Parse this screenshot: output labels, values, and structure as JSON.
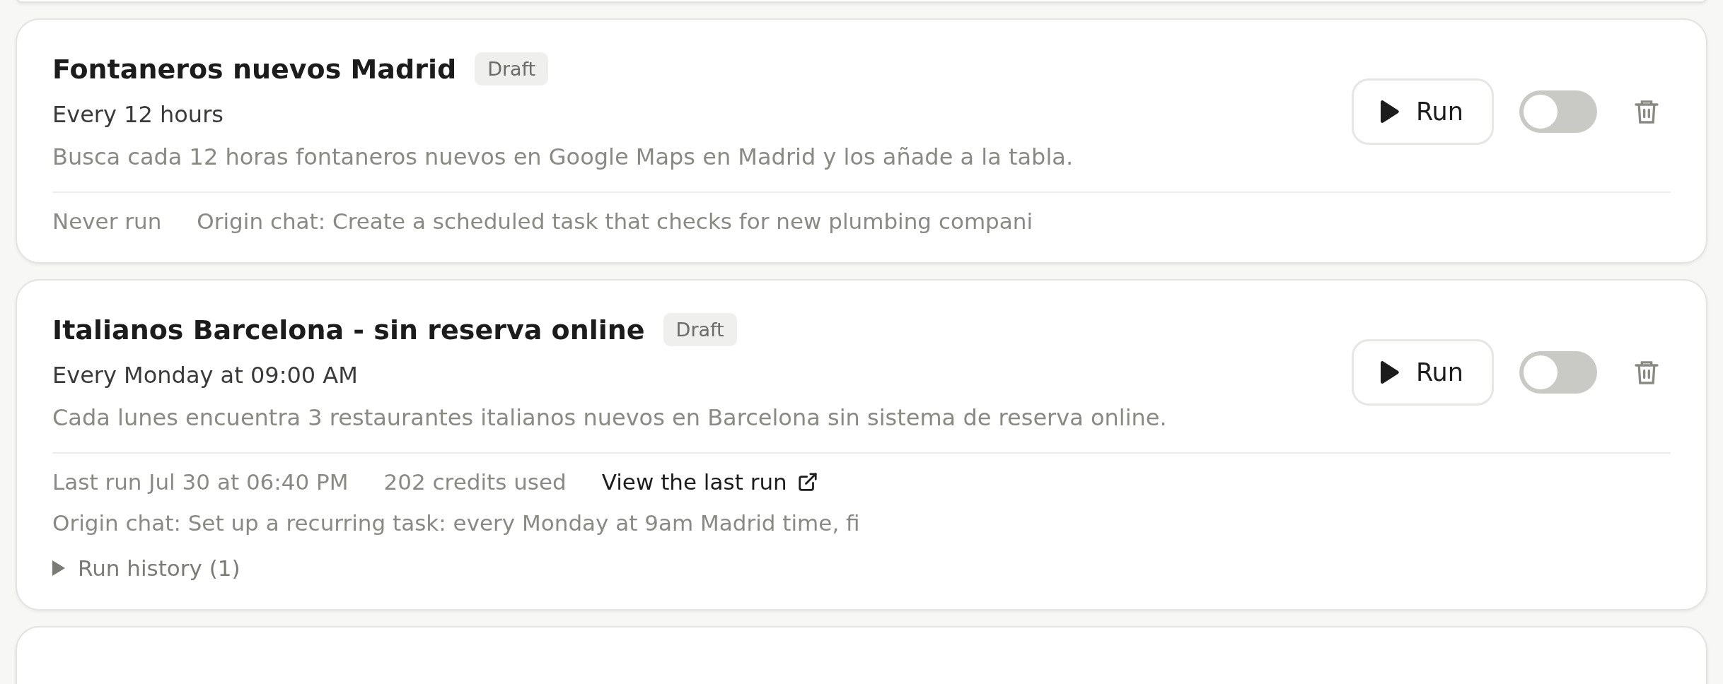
{
  "tasks": [
    {
      "title": "Fontaneros nuevos Madrid",
      "badge": "Draft",
      "schedule": "Every 12 hours",
      "description": "Busca cada 12 horas fontaneros nuevos en Google Maps en Madrid y los añade a la tabla.",
      "run_button": "Run",
      "enabled": false,
      "meta": [
        {
          "kind": "text",
          "text": "Never run"
        },
        {
          "kind": "text",
          "text": "Origin chat: Create a scheduled task that checks for new plumbing compani"
        }
      ]
    },
    {
      "title": "Italianos Barcelona - sin reserva online",
      "badge": "Draft",
      "schedule": "Every Monday at 09:00 AM",
      "description": "Cada lunes encuentra 3 restaurantes italianos nuevos en Barcelona sin sistema de reserva online.",
      "run_button": "Run",
      "enabled": false,
      "meta": [
        {
          "kind": "text",
          "text": "Last run Jul 30 at 06:40 PM"
        },
        {
          "kind": "text",
          "text": "202 credits used"
        },
        {
          "kind": "link",
          "text": "View the last run"
        },
        {
          "kind": "text",
          "text": "Origin chat: Set up a recurring task: every Monday at 9am Madrid time, fi"
        }
      ],
      "run_history": {
        "label": "Run history (1)",
        "expanded": false
      }
    }
  ]
}
